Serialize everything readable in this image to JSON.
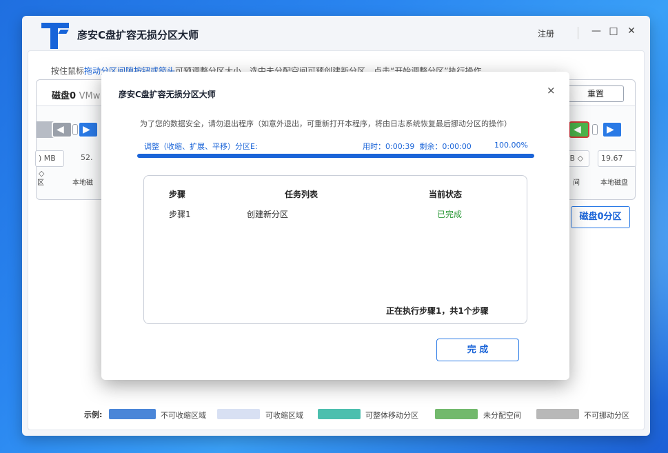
{
  "app": {
    "title": "彦安C盘扩容无损分区大师",
    "register": "注册",
    "window_controls": {
      "minimize": "—",
      "maximize": "□",
      "close": "✕"
    }
  },
  "main": {
    "hint_prefix": "按住鼠标",
    "hint_highlight": "拖动分区间隙按钮或箭头",
    "hint_suffix": "可预调整分区大小，选中未分配空间可预创建新分区，点击“开始调整分区”执行操作",
    "disk": {
      "name": "磁盘0",
      "model": "VMw",
      "reset_button": "重置",
      "left_size": ") MB",
      "left_size2": "52.",
      "right_size": "GB",
      "right_size2": "19.67",
      "left_label_a": "区",
      "left_label_b": "本地磁",
      "right_label_a": "间",
      "right_label_b": "本地磁盘"
    },
    "split_button": "磁盘0分区"
  },
  "legend": {
    "title": "示例:",
    "items": [
      {
        "label": "不可收缩区域",
        "color": "#4a86d8"
      },
      {
        "label": "可收缩区域",
        "color": "#d8e0f3"
      },
      {
        "label": "可整体移动分区",
        "color": "#4cbfae"
      },
      {
        "label": "未分配空间",
        "color": "#72b96c"
      },
      {
        "label": "不可挪动分区",
        "color": "#b8b8b8"
      }
    ]
  },
  "dialog": {
    "title": "彦安C盘扩容无损分区大师",
    "close": "×",
    "notice": "为了您的数据安全，请勿退出程序（如意外退出，可重新打开本程序，将由日志系统恢复最后挪动分区的操作）",
    "operation": "调整（收缩、扩展、平移）分区E:",
    "elapsed": "用时：0:00:39",
    "remaining": "剩余：0:00:00",
    "percent": "100.00%",
    "progress": 1.0,
    "table": {
      "headers": [
        "步骤",
        "任务列表",
        "当前状态"
      ],
      "rows": [
        {
          "step": "步骤1",
          "task": "创建新分区",
          "status": "已完成"
        }
      ],
      "footer": "正在执行步骤1，共1个步骤"
    },
    "finish_button": "完 成"
  }
}
